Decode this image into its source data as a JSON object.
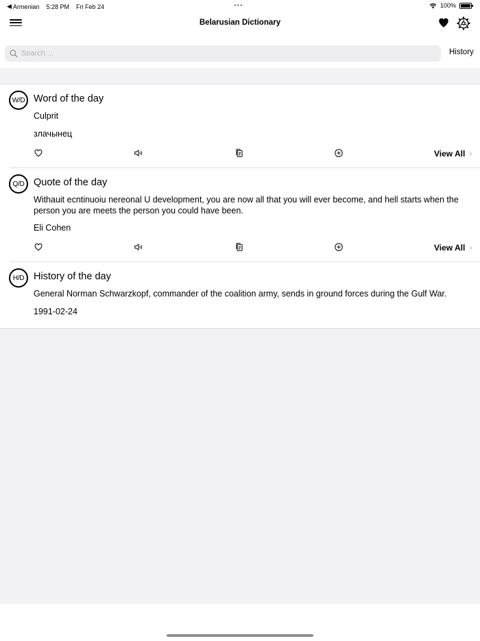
{
  "status_bar": {
    "back_app": "Armenian",
    "time": "5:28 PM",
    "date": "Fri Feb 24",
    "dots": "•••",
    "battery": "100%"
  },
  "nav": {
    "title": "Belarusian Dictionary"
  },
  "search": {
    "placeholder": "Search ...",
    "history_label": "History"
  },
  "cards": {
    "word": {
      "badge": "W/D",
      "title": "Word of the day",
      "word": "Culprit",
      "translation": "злачынец",
      "view_all": "View All"
    },
    "quote": {
      "badge": "Q/D",
      "title": "Quote of the day",
      "text": "Withauit ecntinuoiu nereonal U development, you are now all that you will ever become, and hell starts when the person you are meets the person you could have been.",
      "author": "Eli Cohen",
      "view_all": "View All"
    },
    "history": {
      "badge": "H/D",
      "title": "History of the day",
      "text": "General Norman Schwarzkopf, commander of the coalition army, sends in ground forces during the Gulf War.",
      "date": "1991-02-24"
    }
  },
  "icons": {
    "menu": "hamburger-icon",
    "favorites": "heart-filled-icon",
    "settings": "gear-icon",
    "search": "search-icon",
    "like": "heart-outline-icon",
    "speak": "speaker-icon",
    "copy": "copy-icon",
    "add": "plus-circle-icon"
  }
}
